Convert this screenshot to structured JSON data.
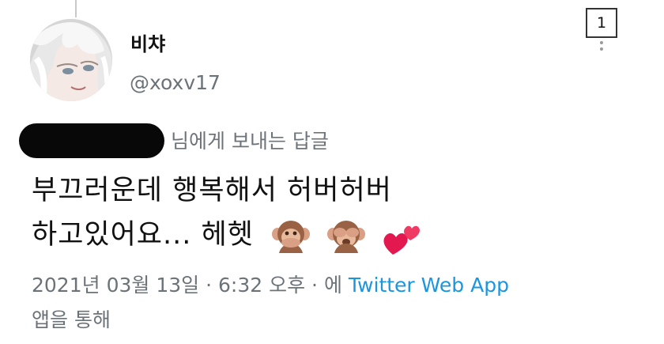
{
  "author": {
    "display_name": "비챠",
    "handle": "@xoxv17"
  },
  "corner_box": {
    "number": "1"
  },
  "reply": {
    "to_suffix": "님에게 보내는 답글"
  },
  "tweet": {
    "line1": "부끄러운데 행복해서 허버허버",
    "line2": "하고있어요... 헤헷",
    "emojis": [
      "speak-no-evil-monkey",
      "see-no-evil-monkey",
      "two-hearts"
    ]
  },
  "meta": {
    "date": "2021년 03월 13일",
    "time": "6:32 오후",
    "prefix": "에",
    "app_name": "Twitter Web App",
    "suffix": "앱을 통해"
  },
  "colors": {
    "app_link": "#1b95e0",
    "secondary_text": "#6b7378"
  }
}
